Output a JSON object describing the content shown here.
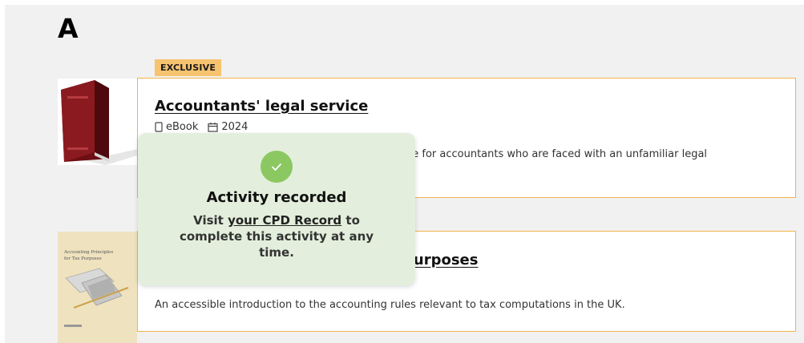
{
  "section": {
    "letter": "A"
  },
  "items": [
    {
      "badge": "EXCLUSIVE",
      "title": "Accountants' legal service",
      "format": "eBook",
      "year": "2024",
      "description_visible": "de for accountants who are faced with an unfamiliar legal",
      "thumbnail": "red-binder-book-cover"
    },
    {
      "title_visible": "purposes",
      "description": "An accessible introduction to the accounting rules relevant to tax computations in the UK.",
      "thumbnail": "accounting-principles-book-cover",
      "cover_text": "Accounting Principles for Tax Purposes"
    }
  ],
  "toast": {
    "icon": "check-circle-icon",
    "title": "Activity recorded",
    "body_prefix": "Visit ",
    "link_text": "your CPD Record",
    "body_suffix": " to complete this activity at any time."
  },
  "colors": {
    "page_bg": "#f1f1f1",
    "card_border": "#f0b44c",
    "badge_bg": "#f7c36f",
    "toast_bg": "#e3efdc",
    "check_green": "#8bc862"
  }
}
